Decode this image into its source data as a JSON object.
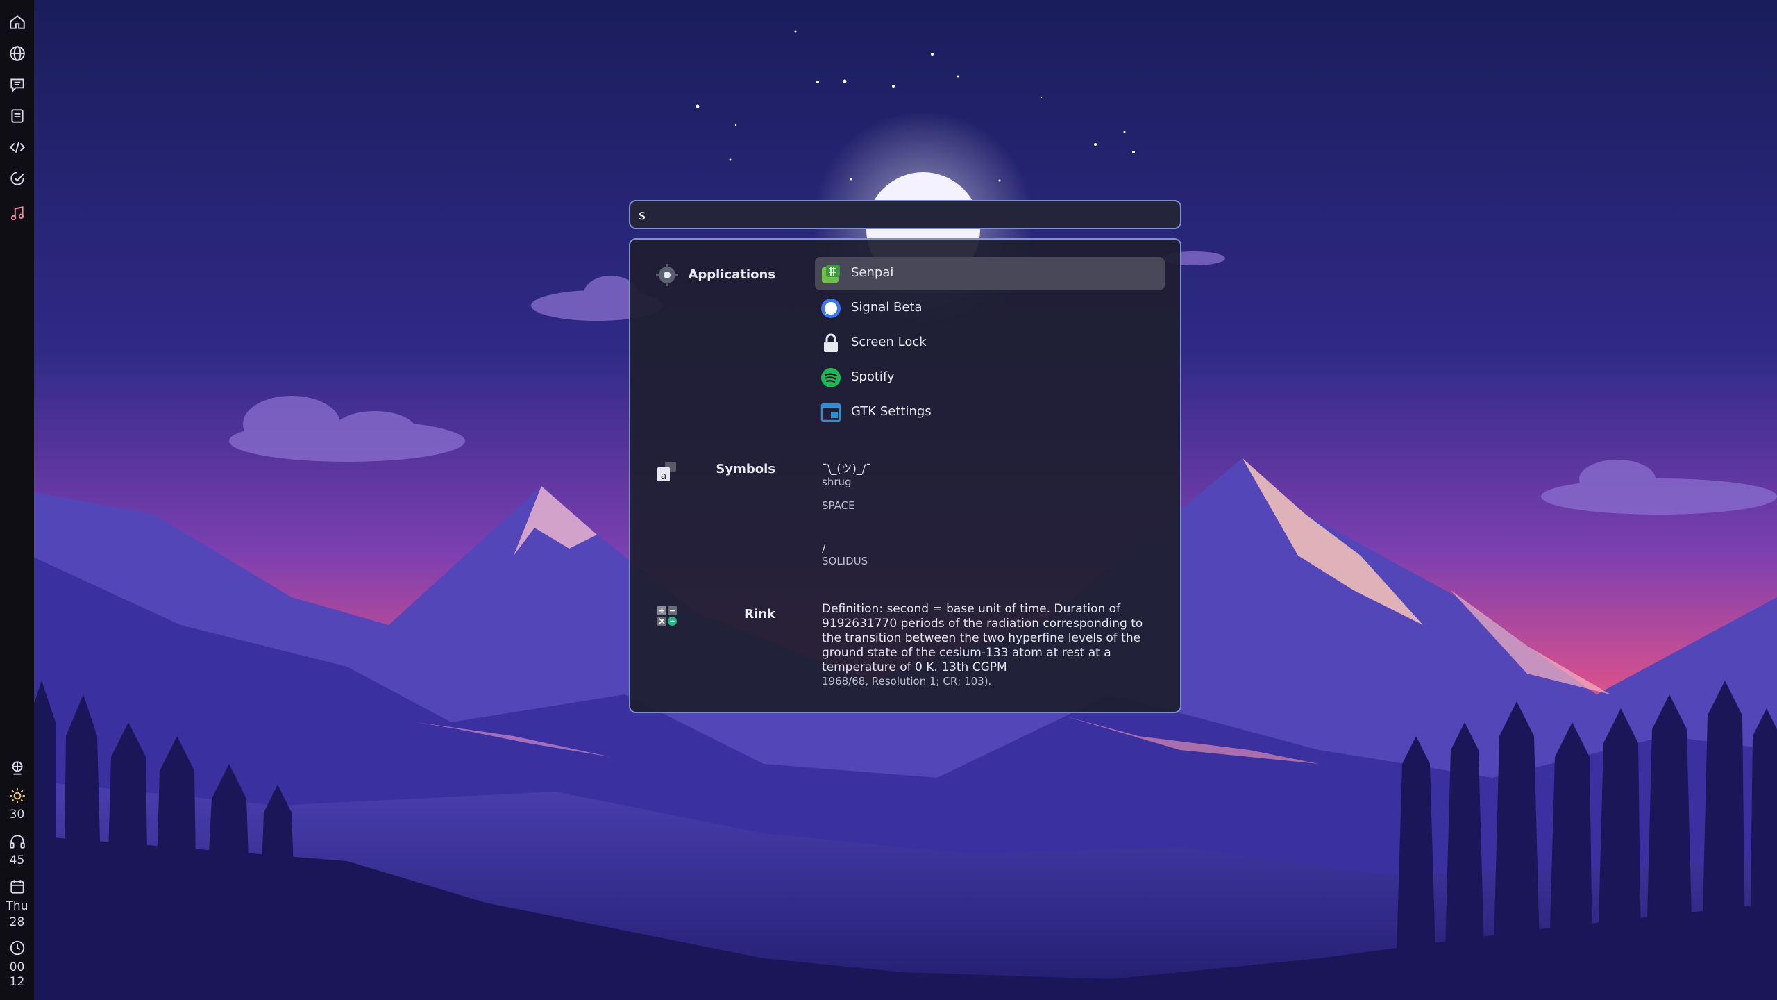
{
  "search": {
    "value": "s",
    "placeholder": ""
  },
  "sidebar": {
    "top_icons": [
      "home-icon",
      "globe-icon",
      "chat-icon",
      "notes-icon",
      "code-icon",
      "activity-icon",
      "music-icon"
    ],
    "status": {
      "brightness": "30",
      "volume": "45",
      "day_name": "Thu",
      "day_number": "28",
      "hour": "00",
      "minute": "12"
    }
  },
  "launcher": {
    "applications": {
      "label": "Applications",
      "items": [
        {
          "label": "Senpai",
          "icon": "senpai-icon",
          "selected": true
        },
        {
          "label": "Signal Beta",
          "icon": "signal-icon"
        },
        {
          "label": "Screen Lock",
          "icon": "lock-icon"
        },
        {
          "label": "Spotify",
          "icon": "spotify-icon"
        },
        {
          "label": "GTK Settings",
          "icon": "gtk-settings-icon"
        }
      ]
    },
    "symbols": {
      "label": "Symbols",
      "items": [
        {
          "glyph": "¯\\_(ツ)_/¯",
          "name": "shrug"
        },
        {
          "glyph": " ",
          "name": "SPACE"
        },
        {
          "glyph": "/",
          "name": "SOLIDUS"
        }
      ]
    },
    "rink": {
      "label": "Rink",
      "definition": "Definition: second = base unit of time. Duration of 9192631770 periods of the radiation corresponding to the transition between the two hyperfine levels of the ground state of the cesium-133 atom at rest at a temperature of 0 K. 13th CGPM",
      "source": "1968/68, Resolution 1; CR; 103)."
    }
  },
  "colors": {
    "accent_border": "#7f8fd0",
    "panel_bg": "#1e1e30",
    "selected_bg": "#484858",
    "sidebar_bg": "#0e0e14"
  }
}
